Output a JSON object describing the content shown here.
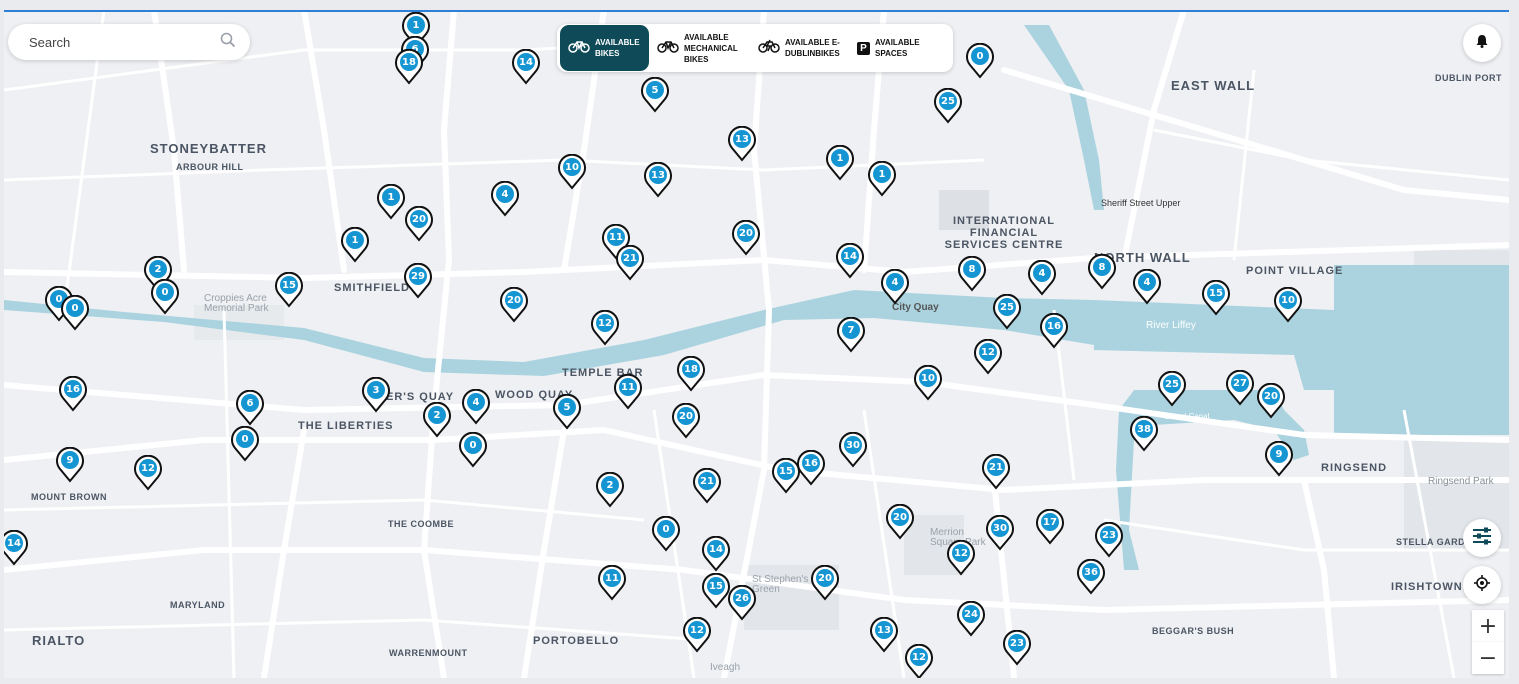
{
  "search": {
    "placeholder": "Search",
    "icon": "search-icon"
  },
  "filters": [
    {
      "label": "AVAILABLE BIKES",
      "icon": "bike-icon",
      "active": true
    },
    {
      "label": "AVAILABLE MECHANICAL BIKES",
      "icon": "mechanical-bike-icon",
      "active": false
    },
    {
      "label": "AVAILABLE E-DUBLINBIKES",
      "icon": "ebike-icon",
      "active": false
    },
    {
      "label": "AVAILABLE SPACES",
      "icon": "parking-icon",
      "active": false
    }
  ],
  "controls": {
    "notifications_icon": "bell-icon",
    "filter_settings_icon": "sliders-icon",
    "locate_icon": "locate-icon",
    "zoom_in": "+",
    "zoom_out": "−"
  },
  "colors": {
    "pin": "#1596d3",
    "pin_border": "#111111",
    "active_filter": "#0e4a58",
    "water": "#aad3df"
  },
  "map_labels": {
    "stoneybatter": "STONEYBATTER",
    "arbour_hill": "ARBOUR HILL",
    "smithfield": "SMITHFIELD",
    "croppies": "Croppies Acre Memorial Park",
    "the_liberties": "THE LIBERTIES",
    "the_coombe": "THE COOMBE",
    "mount_brown": "MOUNT BROWN",
    "maryland": "MARYLAND",
    "rialto": "RIALTO",
    "portobello": "PORTOBELLO",
    "warrenmount": "WARRENMOUNT",
    "temple_bar": "TEMPLE BAR",
    "wood_quay": "WOOD QUAY",
    "merchants_quay": "ER'S QUAY",
    "ifsc": "INTERNATIONAL FINANCIAL SERVICES CENTRE",
    "north_wall": "NORTH WALL",
    "point_village": "POINT VILLAGE",
    "east_wall": "EAST WALL",
    "dublin_port": "DUBLIN PORT",
    "ringsend": "RINGSEND",
    "ringsend_park": "Ringsend Park",
    "stella_gardens": "STELLA GARDENS",
    "irishtown": "IRISHTOWN",
    "beggars_bush": "BEGGAR'S BUSH",
    "river_liffey": "River Liffey",
    "city_quay": "City Quay",
    "merrion_square": "Merrion Square Park",
    "stephens_green": "St Stephen's Green",
    "iveagh": "Iveagh",
    "sheriff_street": "Sheriff Street Upper",
    "grand_canal": "Grand Canal"
  },
  "stations": [
    {
      "n": 1
    },
    {
      "n": 6
    },
    {
      "n": 18
    },
    {
      "n": 14
    },
    {
      "n": 5
    },
    {
      "n": 0
    },
    {
      "n": 25
    },
    {
      "n": 13
    },
    {
      "n": 10
    },
    {
      "n": 13
    },
    {
      "n": 1
    },
    {
      "n": 1
    },
    {
      "n": 1
    },
    {
      "n": 20
    },
    {
      "n": 4
    },
    {
      "n": 1
    },
    {
      "n": 11
    },
    {
      "n": 21
    },
    {
      "n": 20
    },
    {
      "n": 2
    },
    {
      "n": 0
    },
    {
      "n": 15
    },
    {
      "n": 29
    },
    {
      "n": 0
    },
    {
      "n": 0
    },
    {
      "n": 20
    },
    {
      "n": 12
    },
    {
      "n": 14
    },
    {
      "n": 4
    },
    {
      "n": 8
    },
    {
      "n": 4
    },
    {
      "n": 8
    },
    {
      "n": 4
    },
    {
      "n": 15
    },
    {
      "n": 10
    },
    {
      "n": 25
    },
    {
      "n": 16
    },
    {
      "n": 7
    },
    {
      "n": 12
    },
    {
      "n": 18
    },
    {
      "n": 16
    },
    {
      "n": 3
    },
    {
      "n": 6
    },
    {
      "n": 4
    },
    {
      "n": 2
    },
    {
      "n": 11
    },
    {
      "n": 5
    },
    {
      "n": 10
    },
    {
      "n": 25
    },
    {
      "n": 27
    },
    {
      "n": 20
    },
    {
      "n": 38
    },
    {
      "n": 0
    },
    {
      "n": 0
    },
    {
      "n": 20
    },
    {
      "n": 30
    },
    {
      "n": 9
    },
    {
      "n": 12
    },
    {
      "n": 15
    },
    {
      "n": 16
    },
    {
      "n": 2
    },
    {
      "n": 21
    },
    {
      "n": 21
    },
    {
      "n": 9
    },
    {
      "n": 20
    },
    {
      "n": 30
    },
    {
      "n": 17
    },
    {
      "n": 23
    },
    {
      "n": 12
    },
    {
      "n": 14
    },
    {
      "n": 0
    },
    {
      "n": 14
    },
    {
      "n": 11
    },
    {
      "n": 15
    },
    {
      "n": 26
    },
    {
      "n": 20
    },
    {
      "n": 36
    },
    {
      "n": 24
    },
    {
      "n": 13
    },
    {
      "n": 12
    },
    {
      "n": 12
    },
    {
      "n": 23
    }
  ]
}
